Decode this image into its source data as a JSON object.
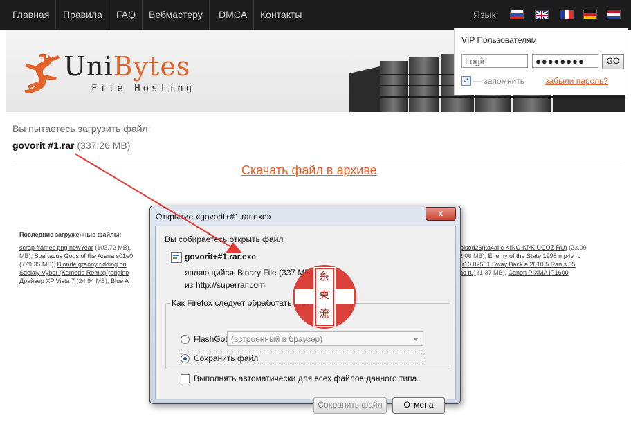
{
  "nav": {
    "items": [
      "Главная",
      "Правила",
      "FAQ",
      "Вебмастеру",
      "DMCA",
      "Контакты"
    ],
    "language_label": "Язык:",
    "flags": [
      "Russian",
      "English",
      "French",
      "German",
      "Dutch"
    ]
  },
  "brand": {
    "name_part1": "Uni",
    "name_part2": "Bytes",
    "tagline": "File Hosting",
    "accent_color": "#e2622a"
  },
  "login": {
    "title": "VIP Пользователям",
    "login_placeholder": "Login",
    "password_value": "●●●●●●●●",
    "go_label": "GO",
    "remember_label": "— запомнить",
    "remember_checked": true,
    "forgot_label": "забыли пароль?"
  },
  "download": {
    "prompt": "Вы пытаетесь загрузить файл:",
    "filename": "govorit #1.rar",
    "filesize": "(337.26 MB)",
    "archive_link": "Скачать файл в архиве"
  },
  "recent": {
    "title": "Последние загруженные файлы:",
    "row1_left": {
      "link": "scrap frames png newYear",
      "suffix": " (103.72 MB),"
    },
    "row1_right": {
      "link": "episod26(ka4ai c KINO KPK UCOZ RU)",
      "suffix": " (23.09"
    },
    "row2_left": {
      "prefix": "MB), ",
      "link": "Spartacus Gods of the Arena s01e0"
    },
    "row2_right": {
      "prefix": "2.06 MB), ",
      "link": "Enemy of the State 1998 mp4v ru"
    },
    "row3_left": {
      "prefix": "(729.35 MB), ",
      "link": "Blonde granny ridding on"
    },
    "row3_right": {
      "link": "r10 02551 Sway Back a 2010 5 Ran s 05"
    },
    "row4_left": {
      "link": "Sdelaiy Vybor (Kamodo Remix)(redgino"
    },
    "row4_right": {
      "link": "ino ru)",
      "suffix": " (1.37 MB), ",
      "link2": "Canon PIXMA iP1600"
    },
    "row5_left": {
      "link": "Драйвер XP Vista 7",
      "suffix": " (24.94 MB), ",
      "link2": "Blue A"
    }
  },
  "dialog": {
    "title": "Открытие «govorit+#1.rar.exe»",
    "close_label": "x",
    "intro": "Вы собираетесь открыть файл",
    "filename": "govorit+#1.rar.exe",
    "type_prefix": "являющийся",
    "type_value": "Binary File (337 MB)",
    "from_prefix": "из",
    "from_value": "http://superrar.com",
    "group_label": "Как Firefox следует обработать этот файл?",
    "option_open": "FlashGot",
    "option_open_select": "(встроенный в браузер)",
    "option_save": "Сохранить файл",
    "auto_label": "Выполнять автоматически для всех файлов данного типа.",
    "save_button": "Сохранить файл",
    "cancel_button": "Отмена"
  },
  "stamp": {
    "chars": [
      "糸",
      "東",
      "流"
    ],
    "color": "#b0251f"
  }
}
